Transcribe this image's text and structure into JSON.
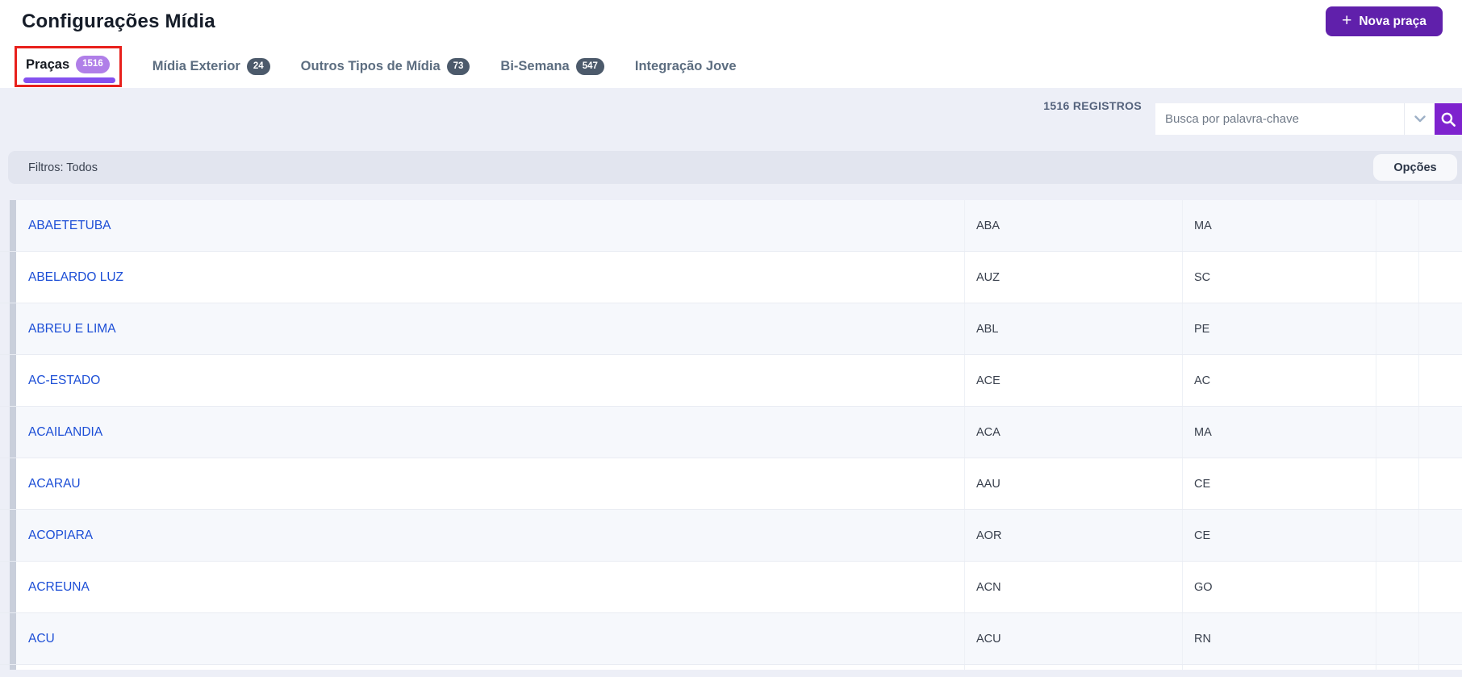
{
  "page": {
    "title": "Configurações Mídia"
  },
  "header": {
    "new_button_label": "Nova praça"
  },
  "tabs": [
    {
      "label": "Praças",
      "badge": "1516",
      "active": true,
      "annotated": true
    },
    {
      "label": "Mídia Exterior",
      "badge": "24",
      "active": false
    },
    {
      "label": "Outros Tipos de Mídia",
      "badge": "73",
      "active": false
    },
    {
      "label": "Bi-Semana",
      "badge": "547",
      "active": false
    },
    {
      "label": "Integração Jove",
      "badge": "",
      "active": false
    }
  ],
  "toolbar": {
    "records_label": "1516 REGISTROS",
    "search_placeholder": "Busca por palavra-chave"
  },
  "filter_bar": {
    "label": "Filtros: Todos",
    "options_label": "Opções"
  },
  "table": {
    "rows": [
      {
        "name": "ABAETETUBA",
        "code": "ABA",
        "uf": "MA"
      },
      {
        "name": "ABELARDO LUZ",
        "code": "AUZ",
        "uf": "SC"
      },
      {
        "name": "ABREU E LIMA",
        "code": "ABL",
        "uf": "PE"
      },
      {
        "name": "AC-ESTADO",
        "code": "ACE",
        "uf": "AC"
      },
      {
        "name": "ACAILANDIA",
        "code": "ACA",
        "uf": "MA"
      },
      {
        "name": "ACARAU",
        "code": "AAU",
        "uf": "CE"
      },
      {
        "name": "ACOPIARA",
        "code": "AOR",
        "uf": "CE"
      },
      {
        "name": "ACREUNA",
        "code": "ACN",
        "uf": "GO"
      },
      {
        "name": "ACU",
        "code": "ACU",
        "uf": "RN"
      }
    ]
  },
  "colors": {
    "accent": "#6020ab",
    "search-accent": "#7e22ce",
    "tab-underline": "#8451ef",
    "badge-active": "#b07fe8",
    "badge-inactive": "#4c5a6b",
    "annotation": "#e8201c",
    "link": "#1c4ed6",
    "bg-band": "#edeff7",
    "bg-filter": "#e2e5ef",
    "row-alt": "#f6f8fc",
    "strip": "#c9cfdb"
  }
}
